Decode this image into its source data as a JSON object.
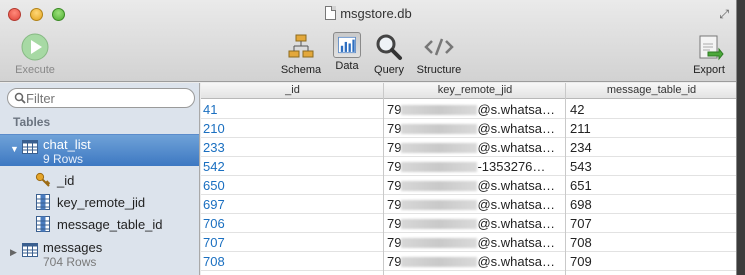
{
  "window": {
    "title": "msgstore.db"
  },
  "toolbar": {
    "execute": "Execute",
    "schema": "Schema",
    "data": "Data",
    "query": "Query",
    "structure": "Structure",
    "export": "Export"
  },
  "sidebar": {
    "filter_placeholder": "Filter",
    "tables_heading": "Tables",
    "tables": [
      {
        "name": "chat_list",
        "rows": "9 Rows"
      },
      {
        "name": "messages",
        "rows": "704 Rows"
      }
    ],
    "columns": [
      "_id",
      "key_remote_jid",
      "message_table_id"
    ]
  },
  "grid": {
    "headers": [
      "_id",
      "key_remote_jid",
      "message_table_id"
    ],
    "rows": [
      {
        "id": "41",
        "jid_prefix": "79",
        "jid_suffix": "@s.whatsa…",
        "msg": "42"
      },
      {
        "id": "210",
        "jid_prefix": "79",
        "jid_suffix": "@s.whatsa…",
        "msg": "211"
      },
      {
        "id": "233",
        "jid_prefix": "79",
        "jid_suffix": "@s.whatsa…",
        "msg": "234"
      },
      {
        "id": "542",
        "jid_prefix": "79",
        "jid_suffix": "-1353276…",
        "msg": "543"
      },
      {
        "id": "650",
        "jid_prefix": "79",
        "jid_suffix": "@s.whatsa…",
        "msg": "651"
      },
      {
        "id": "697",
        "jid_prefix": "79",
        "jid_suffix": "@s.whatsa…",
        "msg": "698"
      },
      {
        "id": "706",
        "jid_prefix": "79",
        "jid_suffix": "@s.whatsa…",
        "msg": "707"
      },
      {
        "id": "707",
        "jid_prefix": "79",
        "jid_suffix": "@s.whatsa…",
        "msg": "708"
      },
      {
        "id": "708",
        "jid_prefix": "79",
        "jid_suffix": "@s.whatsa…",
        "msg": "709"
      }
    ]
  },
  "colors": {
    "selection": "#3d78c2",
    "id_link": "#1a6fc0",
    "sidebar_bg": "#dce3ec"
  }
}
